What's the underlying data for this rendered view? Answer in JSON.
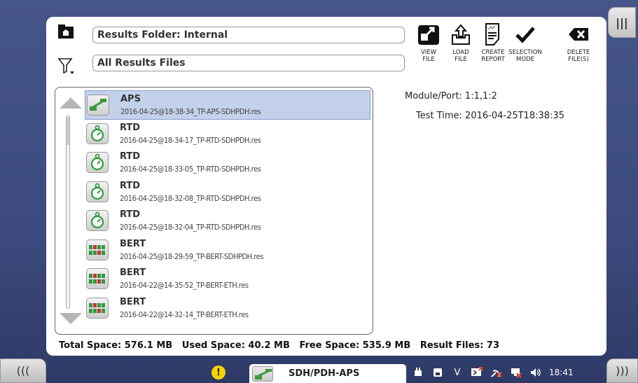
{
  "header": {
    "folder_label": "Results Folder: Internal",
    "filter_label": "All Results Files"
  },
  "toolbar": [
    {
      "name": "view-file-button",
      "label": "VIEW\nFILE",
      "icon": "view-file-icon"
    },
    {
      "name": "load-file-button",
      "label": "LOAD\nFILE",
      "icon": "load-file-icon"
    },
    {
      "name": "create-report-button",
      "label": "CREATE\nREPORT",
      "icon": "create-report-icon"
    },
    {
      "name": "selection-mode-button",
      "label": "SELECTION\nMODE",
      "icon": "checkmark-icon"
    },
    {
      "name": "delete-files-button",
      "label": "DELETE\nFILE(S)",
      "icon": "delete-icon"
    }
  ],
  "files": [
    {
      "name": "APS",
      "file": "2016-04-25@18-38-34_TP-APS-SDHPDH.res",
      "icon": "aps-icon",
      "selected": true
    },
    {
      "name": "RTD",
      "file": "2016-04-25@18-34-17_TP-RTD-SDHPDH.res",
      "icon": "stopwatch-icon",
      "selected": false
    },
    {
      "name": "RTD",
      "file": "2016-04-25@18-33-05_TP-RTD-SDHPDH.res",
      "icon": "stopwatch-icon",
      "selected": false
    },
    {
      "name": "RTD",
      "file": "2016-04-25@18-32-08_TP-RTD-SDHPDH.res",
      "icon": "stopwatch-icon",
      "selected": false
    },
    {
      "name": "RTD",
      "file": "2016-04-25@18-32-04_TP-RTD-SDHPDH.res",
      "icon": "stopwatch-icon",
      "selected": false
    },
    {
      "name": "BERT",
      "file": "2016-04-25@18-29-59_TP-BERT-SDHPDH.res",
      "icon": "bert-icon",
      "selected": false
    },
    {
      "name": "BERT",
      "file": "2016-04-22@14-35-52_TP-BERT-ETH.res",
      "icon": "bert-icon",
      "selected": false
    },
    {
      "name": "BERT",
      "file": "2016-04-22@14-32-14_TP-BERT-ETH.res",
      "icon": "bert-icon",
      "selected": false
    }
  ],
  "details": {
    "module_port": "Module/Port: 1:1,1:2",
    "test_time": "Test Time: 2016-04-25T18:38:35"
  },
  "summary": "Total Space: 576.1 MB   Used Space: 40.2 MB   Free Space: 535.9 MB   Result Files: 73",
  "nav": {
    "top_right": "|||",
    "left": "(((",
    "right": ")))"
  },
  "taskbar": {
    "warning": "!",
    "app_label": "SDH/PDH-APS",
    "tray_v": "V",
    "clock": "18:41"
  },
  "colors": {
    "background": "#3c4a7e",
    "selected_row": "#c3d1ea",
    "warning": "#f5d400",
    "stopwatch": "#2e9a3e"
  }
}
